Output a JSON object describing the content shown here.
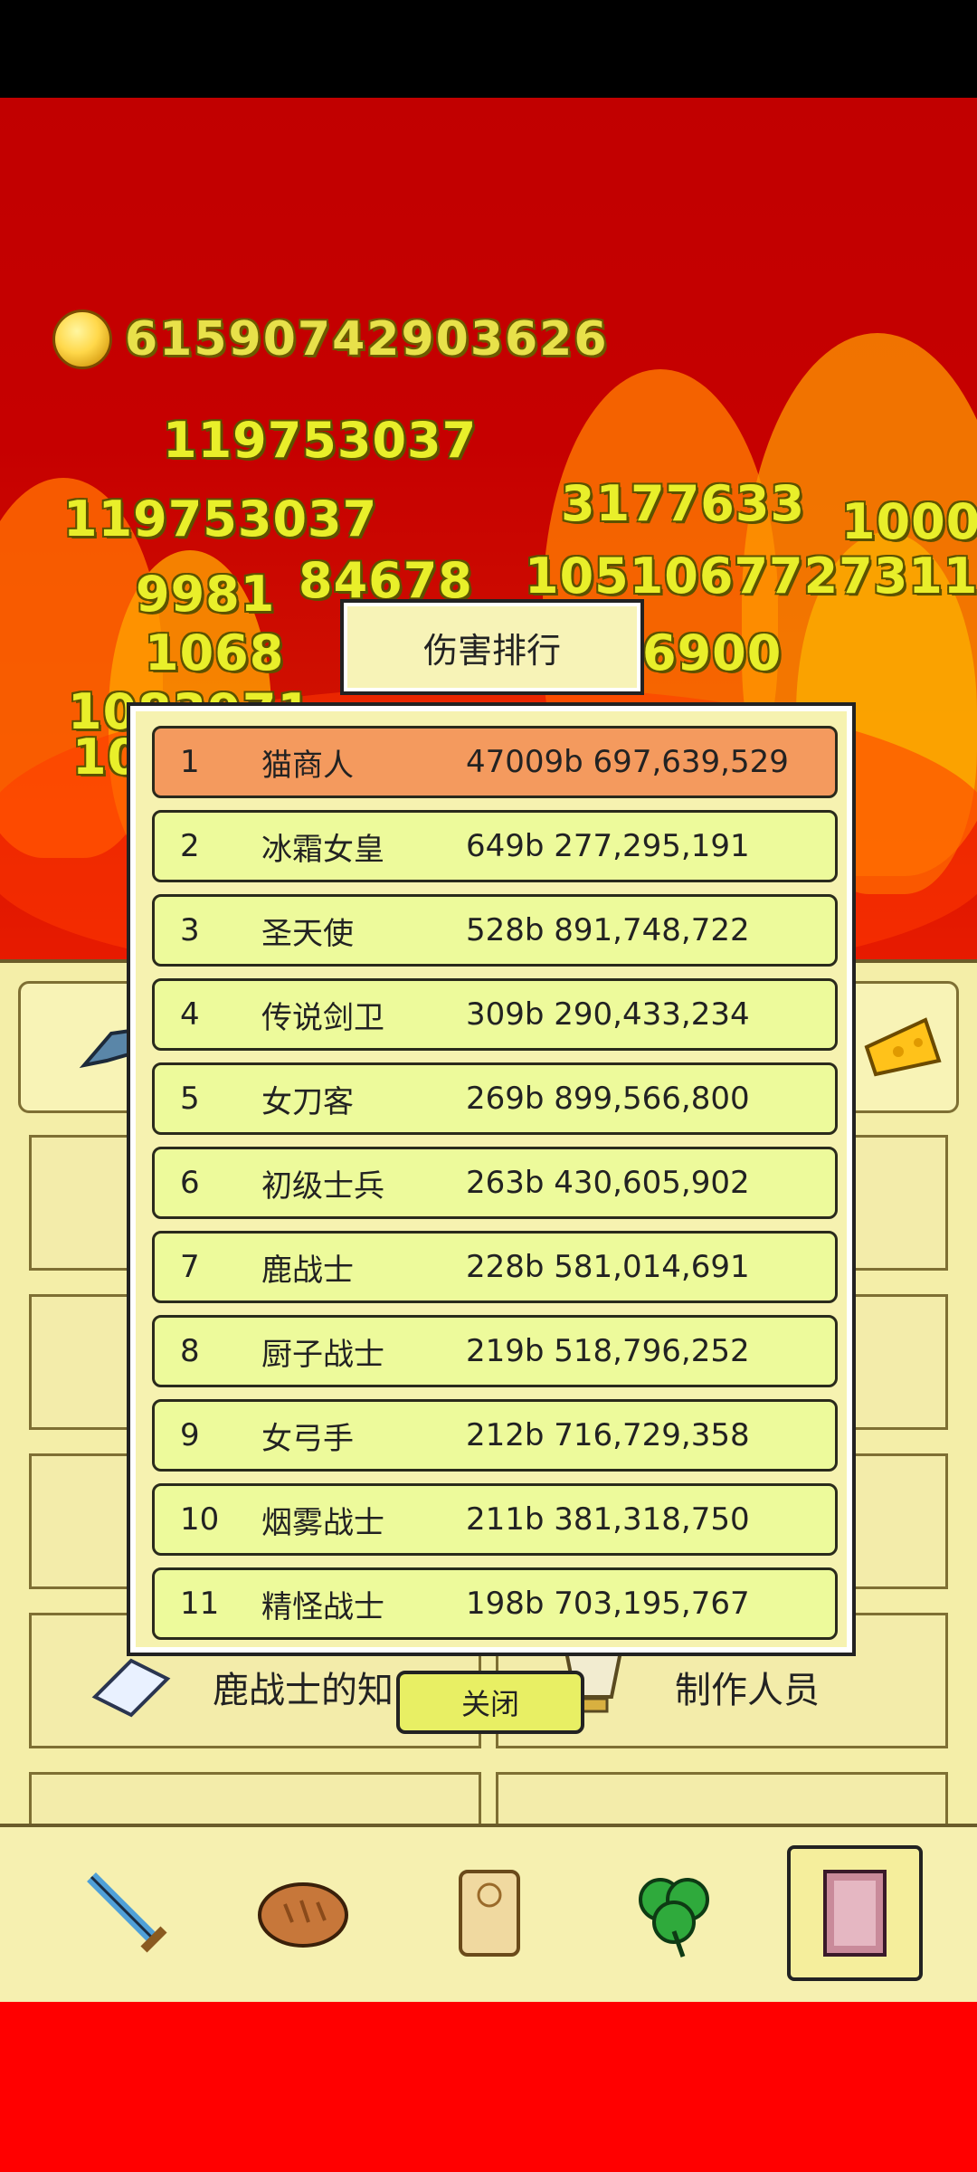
{
  "hud": {
    "gold_amount": "61590742903626"
  },
  "floating_damage": [
    "119753037",
    "119753037",
    "9981",
    "84678",
    "1051067727311",
    "1068",
    "6900",
    "1083971",
    "3177633",
    "1000",
    "10"
  ],
  "dialog": {
    "title": "伤害排行",
    "close_label": "关闭",
    "rows": [
      {
        "rank": "1",
        "name": "猫商人",
        "damage": "47009b 697,639,529"
      },
      {
        "rank": "2",
        "name": "冰霜女皇",
        "damage": "649b 277,295,191"
      },
      {
        "rank": "3",
        "name": "圣天使",
        "damage": "528b 891,748,722"
      },
      {
        "rank": "4",
        "name": "传说剑卫",
        "damage": "309b 290,433,234"
      },
      {
        "rank": "5",
        "name": "女刀客",
        "damage": "269b 899,566,800"
      },
      {
        "rank": "6",
        "name": "初级士兵",
        "damage": "263b 430,605,902"
      },
      {
        "rank": "7",
        "name": "鹿战士",
        "damage": "228b 581,014,691"
      },
      {
        "rank": "8",
        "name": "厨子战士",
        "damage": "219b 518,796,252"
      },
      {
        "rank": "9",
        "name": "女弓手",
        "damage": "212b 716,729,358"
      },
      {
        "rank": "10",
        "name": "烟雾战士",
        "damage": "211b 381,318,750"
      },
      {
        "rank": "11",
        "name": "精怪战士",
        "damage": "198b 703,195,767"
      }
    ]
  },
  "menu": {
    "knowledge_label": "鹿战士的知",
    "credits_label": "制作人员"
  },
  "nav": {
    "items": [
      "sword-icon",
      "bread-icon",
      "scroll-icon",
      "clover-icon",
      "book-icon"
    ],
    "active": "book-icon"
  }
}
